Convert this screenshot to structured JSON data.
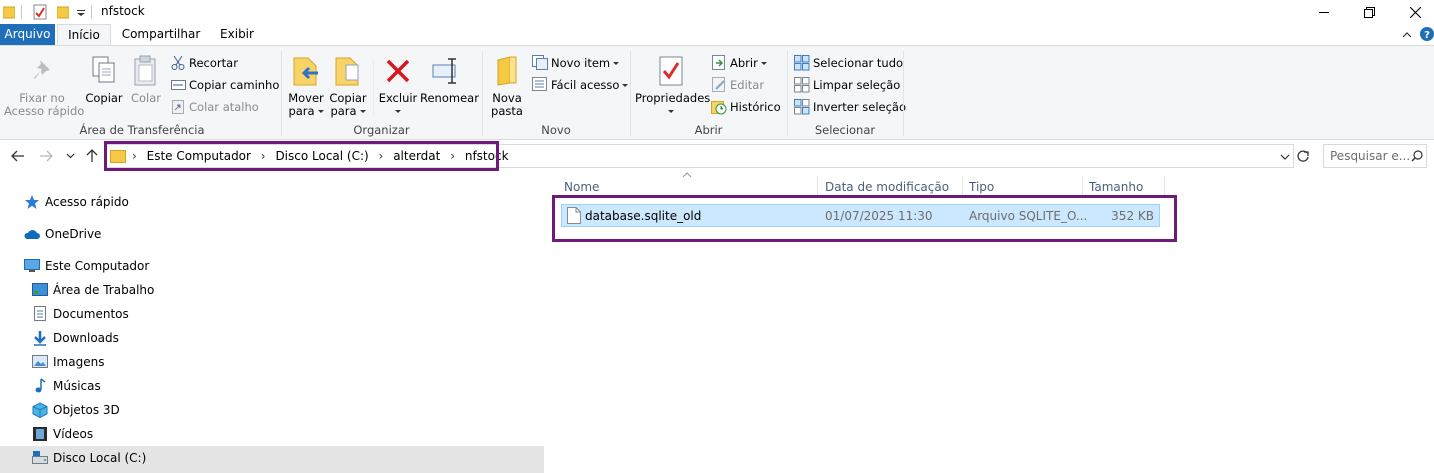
{
  "window": {
    "title": "nfstock"
  },
  "tabs": [
    "Arquivo",
    "Início",
    "Compartilhar",
    "Exibir"
  ],
  "ribbon": {
    "clipboard": {
      "pin_line1": "Fixar no",
      "pin_line2": "Acesso rápido",
      "copy": "Copiar",
      "paste": "Colar",
      "cut": "Recortar",
      "copy_path": "Copiar caminho",
      "paste_shortcut": "Colar atalho",
      "label": "Área de Transferência"
    },
    "organize": {
      "move_line1": "Mover",
      "move_line2": "para",
      "copy_line1": "Copiar",
      "copy_line2": "para",
      "delete": "Excluir",
      "rename": "Renomear",
      "label": "Organizar"
    },
    "new": {
      "folder_line1": "Nova",
      "folder_line2": "pasta",
      "new_item": "Novo item",
      "easy_access": "Fácil acesso",
      "label": "Novo"
    },
    "open": {
      "properties": "Propriedades",
      "open": "Abrir",
      "edit": "Editar",
      "history": "Histórico",
      "label": "Abrir"
    },
    "select": {
      "select_all": "Selecionar tudo",
      "select_none": "Limpar seleção",
      "invert": "Inverter seleção",
      "label": "Selecionar"
    }
  },
  "address": {
    "crumbs": [
      "Este Computador",
      "Disco Local (C:)",
      "alterdat",
      "nfstock"
    ],
    "search_placeholder": "Pesquisar e..."
  },
  "nav_tree": {
    "quick_access": "Acesso rápido",
    "onedrive": "OneDrive",
    "this_pc": "Este Computador",
    "children": [
      "Área de Trabalho",
      "Documentos",
      "Downloads",
      "Imagens",
      "Músicas",
      "Objetos 3D",
      "Vídeos",
      "Disco Local (C:)"
    ]
  },
  "file_list": {
    "columns": [
      "Nome",
      "Data de modificação",
      "Tipo",
      "Tamanho"
    ],
    "rows": [
      {
        "name": "database.sqlite_old",
        "modified": "01/07/2025 11:30",
        "type": "Arquivo SQLITE_O...",
        "size": "352 KB"
      }
    ]
  },
  "colors": {
    "file_tab": "#1e6fb8",
    "selection": "#cce8ff",
    "selection_border": "#99d1ff",
    "highlight_box": "#6e1a7a",
    "accent_folder": "#f6c944"
  }
}
